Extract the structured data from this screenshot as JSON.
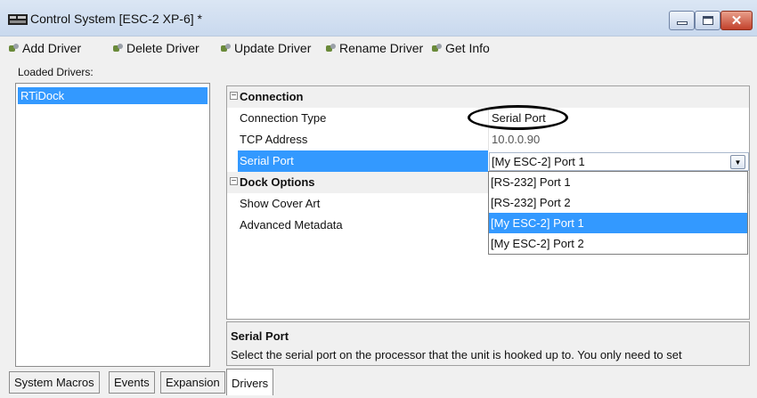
{
  "window": {
    "title": "Control System [ESC-2 XP-6] *"
  },
  "toolbar": {
    "buttons": [
      {
        "label": "Add Driver",
        "icon": "add-driver-icon"
      },
      {
        "label": "Delete Driver",
        "icon": "delete-driver-icon"
      },
      {
        "label": "Update Driver",
        "icon": "update-driver-icon"
      },
      {
        "label": "Rename Driver",
        "icon": "rename-driver-icon"
      },
      {
        "label": "Get Info",
        "icon": "get-info-icon"
      }
    ]
  },
  "drivers": {
    "label": "Loaded Drivers:",
    "items": [
      "RTiDock"
    ],
    "selected": "RTiDock"
  },
  "properties": {
    "categories": [
      {
        "name": "Connection",
        "toggle": "−",
        "props": [
          {
            "name": "Connection Type",
            "value": "Serial Port"
          },
          {
            "name": "TCP Address",
            "value": "10.0.0.90"
          },
          {
            "name": "Serial Port",
            "value": "[My ESC-2] Port 1"
          }
        ]
      },
      {
        "name": "Dock Options",
        "toggle": "−",
        "props": [
          {
            "name": "Show Cover Art",
            "value": ""
          },
          {
            "name": "Advanced Metadata",
            "value": ""
          }
        ]
      }
    ],
    "dropdown": {
      "options": [
        "[RS-232] Port 1",
        "[RS-232] Port 2",
        "[My ESC-2] Port 1",
        "[My ESC-2] Port 2"
      ],
      "highlighted": "[My ESC-2] Port 1"
    }
  },
  "description": {
    "title": "Serial Port",
    "text": "Select the serial port on the processor that the unit is hooked up to. You only need to set"
  },
  "tabs": [
    {
      "label": "System Macros"
    },
    {
      "label": "Events"
    },
    {
      "label": "Expansion"
    },
    {
      "label": "Drivers",
      "active": true
    }
  ],
  "colors": {
    "selection": "#3399ff",
    "titlebar": "#c9d9ee",
    "close": "#c2412b"
  }
}
